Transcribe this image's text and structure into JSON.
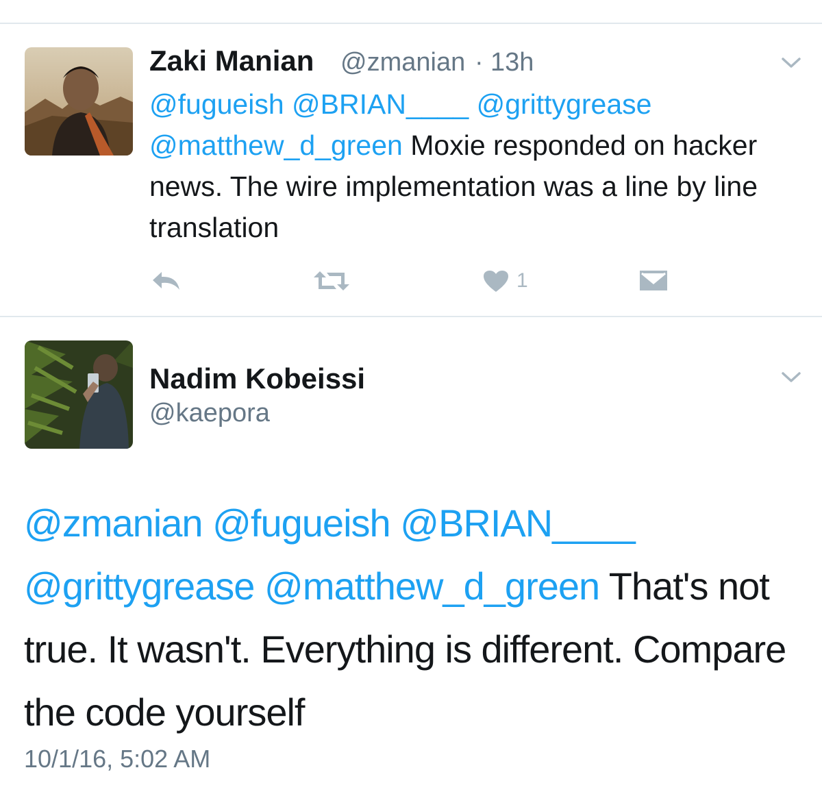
{
  "tweet1": {
    "display_name": "Zaki Manian",
    "handle": "@zmanian",
    "separator": "·",
    "time": "13h",
    "mentions": [
      "@fugueish",
      "@BRIAN____",
      "@grittygrease",
      "@matthew_d_green"
    ],
    "text": "Moxie responded on hacker news. The wire implementation was a line by line translation",
    "like_count": "1",
    "actions": {
      "reply": "reply-icon",
      "retweet": "retweet-icon",
      "like": "heart-icon",
      "dm": "envelope-icon"
    }
  },
  "tweet2": {
    "display_name": "Nadim Kobeissi",
    "handle": "@kaepora",
    "mentions": [
      "@zmanian",
      "@fugueish",
      "@BRIAN____",
      "@grittygrease",
      "@matthew_d_green"
    ],
    "text": "That's not true. It wasn't. Everything is different. Compare the code yourself",
    "timestamp": "10/1/16, 5:02 AM"
  },
  "colors": {
    "link": "#1da1f2",
    "text": "#14171a",
    "secondary": "#657786",
    "icon": "#aab8c2",
    "divider": "#e1e8ed"
  }
}
